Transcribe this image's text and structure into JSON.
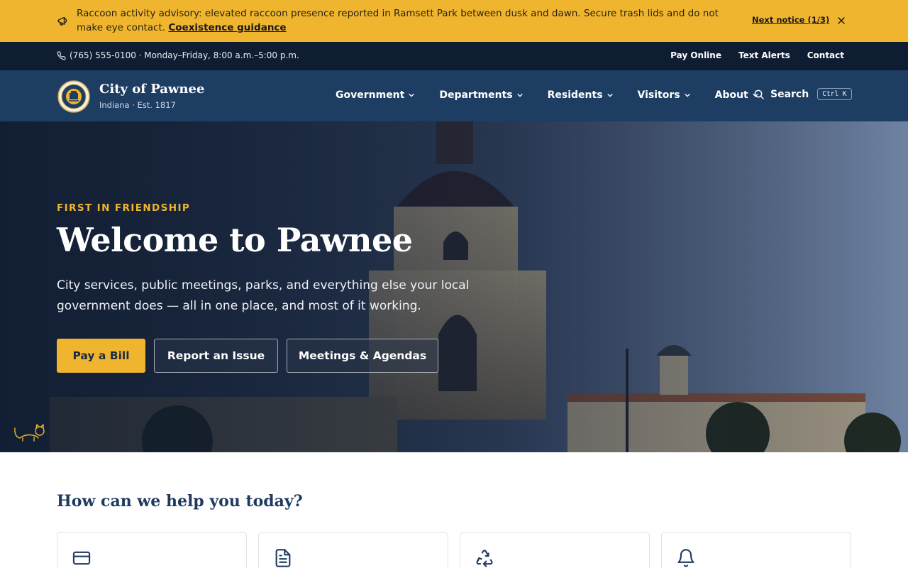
{
  "alert": {
    "message": "Raccoon activity advisory: elevated raccoon presence reported in Ramsett Park between dusk and dawn. Secure trash lids and do not make eye contact.",
    "link_label": "Coexistence guidance",
    "next_label": "Next notice (1/3)",
    "icons": [
      "megaphone-icon",
      "close-icon"
    ]
  },
  "utility": {
    "phone": "(765) 555-0100 · Monday–Friday, 8:00 a.m.–5:00 p.m.",
    "links": [
      "Pay Online",
      "Text Alerts",
      "Contact"
    ]
  },
  "header": {
    "brand_name": "City of Pawnee",
    "brand_sub": "Indiana · Est. 1817",
    "nav": [
      "Government",
      "Departments",
      "Residents",
      "Visitors",
      "About"
    ],
    "search_label": "Search",
    "search_shortcut": "Ctrl K"
  },
  "hero": {
    "eyebrow": "FIRST IN FRIENDSHIP",
    "title": "Welcome to Pawnee",
    "description": "City services, public meetings, parks, and everything else your local government does — all in one place, and most of it working.",
    "buttons": {
      "primary": "Pay a Bill",
      "report": "Report an Issue",
      "meetings": "Meetings & Agendas"
    }
  },
  "help": {
    "title": "How can we help you today?",
    "card_icons": [
      "credit-card-icon",
      "document-icon",
      "recycle-icon",
      "bell-icon"
    ]
  },
  "colors": {
    "accent": "#f0b52e",
    "navy_dark": "#0f1d33",
    "navy": "#1e3d63",
    "heading": "#1e3a5f"
  }
}
